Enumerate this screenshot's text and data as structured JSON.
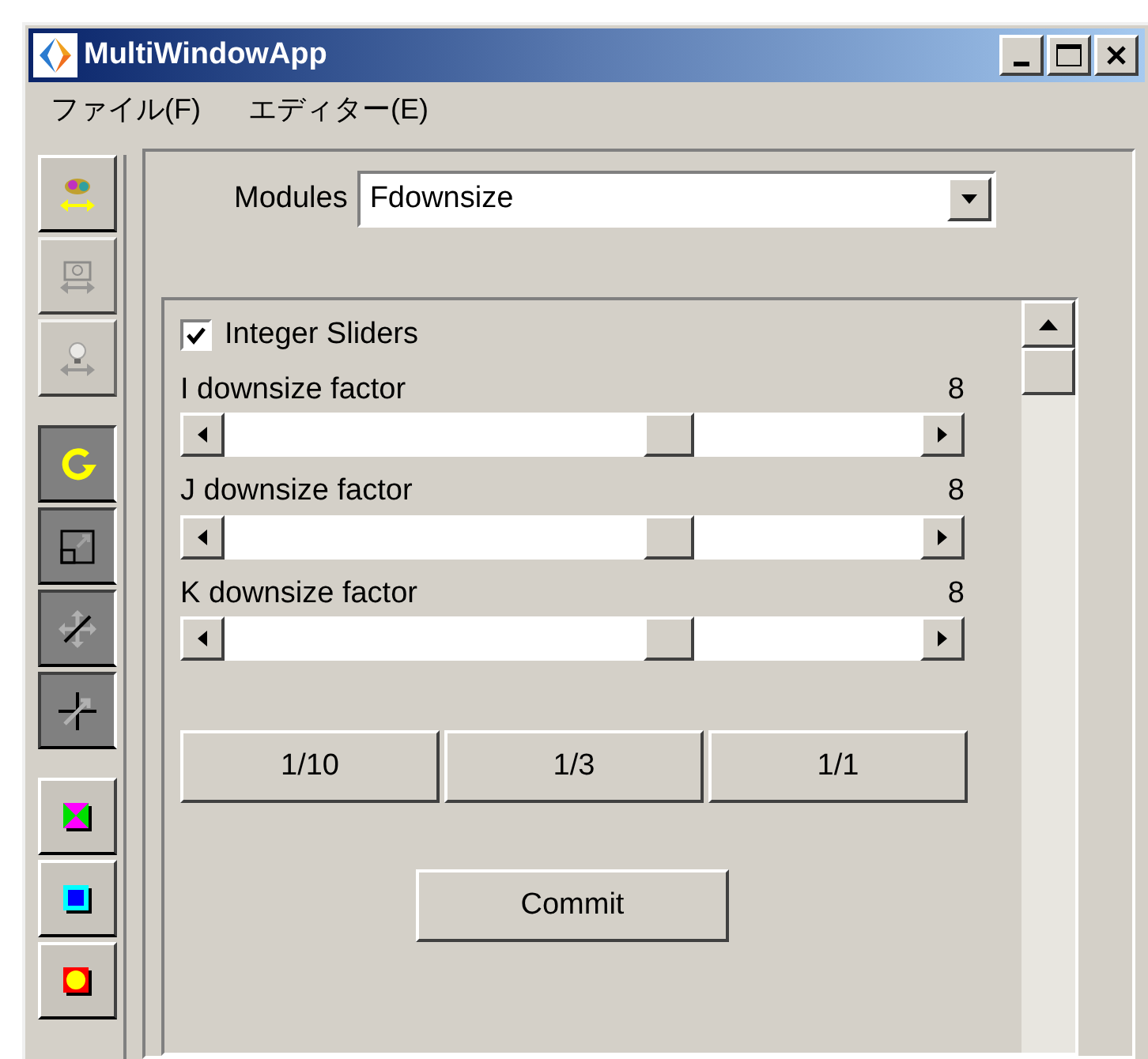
{
  "window": {
    "title": "MultiWindowApp"
  },
  "menu": [
    "ファイル(F)",
    "エディター(E)"
  ],
  "toolbar": [
    [
      {
        "disabled": false,
        "pressed": false
      },
      {
        "disabled": true,
        "pressed": false
      },
      {
        "disabled": true,
        "pressed": false
      }
    ],
    [
      {
        "disabled": false,
        "pressed": true
      },
      {
        "disabled": false,
        "pressed": true
      },
      {
        "disabled": false,
        "pressed": true
      },
      {
        "disabled": false,
        "pressed": true
      }
    ],
    [
      {
        "disabled": false,
        "pressed": false
      },
      {
        "disabled": false,
        "pressed": false
      },
      {
        "disabled": false,
        "pressed": false
      }
    ]
  ],
  "modules": {
    "label": "Modules",
    "value": "Fdownsize"
  },
  "integer_sliders": {
    "label": "Integer Sliders",
    "checked": true
  },
  "sliders": [
    {
      "label": "I downsize factor",
      "reading": "8",
      "level": 0.65
    },
    {
      "label": "J downsize factor",
      "reading": "8",
      "level": 0.65
    },
    {
      "label": "K downsize factor",
      "reading": "8",
      "level": 0.65
    }
  ],
  "preset_buttons": [
    "1/10",
    "1/3",
    "1/1"
  ],
  "commit_button": "Commit"
}
